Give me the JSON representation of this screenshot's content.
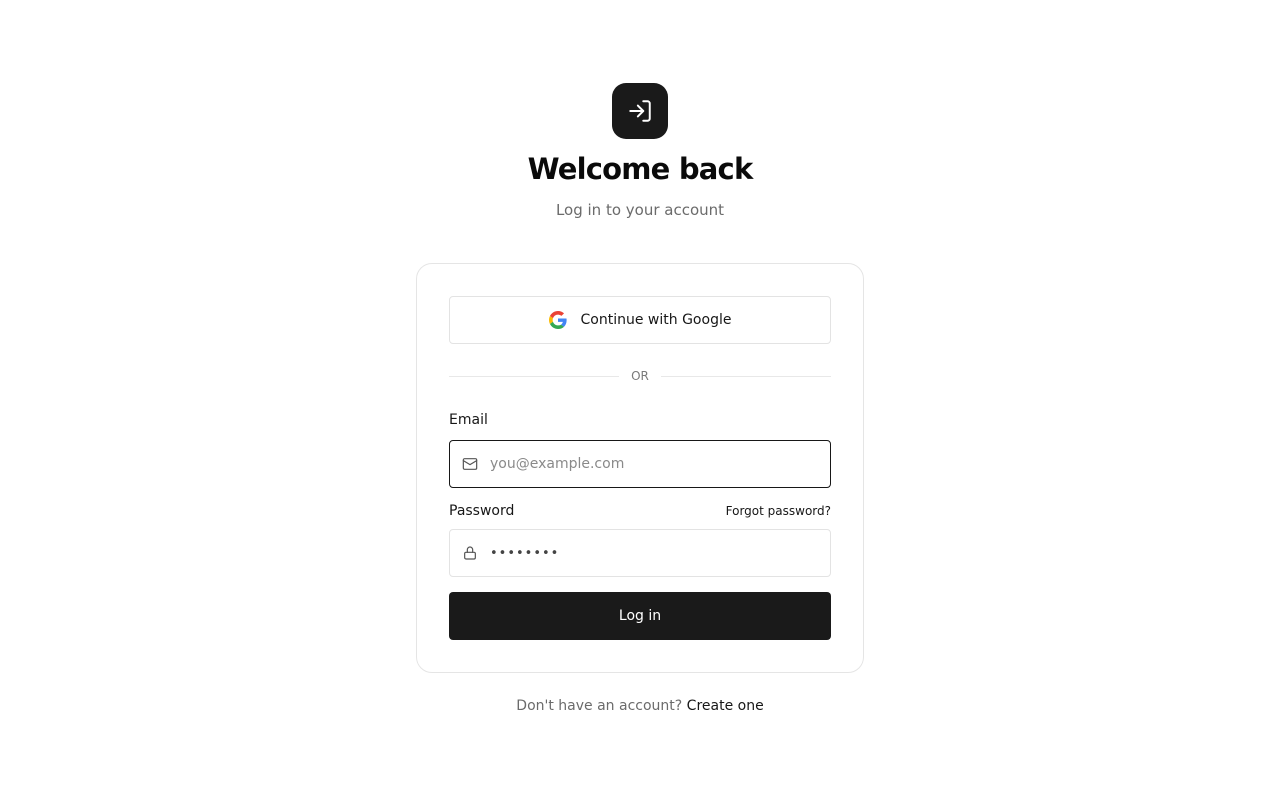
{
  "header": {
    "logo_icon": "log-in-icon",
    "title": "Welcome back",
    "subtitle": "Log in to your account"
  },
  "card": {
    "google_button": {
      "label": "Continue with Google",
      "icon": "google-icon"
    },
    "divider_text": "OR",
    "email": {
      "label": "Email",
      "placeholder": "you@example.com",
      "value": "",
      "icon": "mail-icon"
    },
    "password": {
      "label": "Password",
      "forgot_link": "Forgot password?",
      "masked_value": "••••••••",
      "icon": "lock-icon"
    },
    "submit_label": "Log in"
  },
  "footer": {
    "prompt": "Don't have an account?",
    "link": "Create one"
  },
  "colors": {
    "primary": "#1a1a1a",
    "muted_text": "#6b6b6b",
    "border": "#e3e3e3"
  }
}
